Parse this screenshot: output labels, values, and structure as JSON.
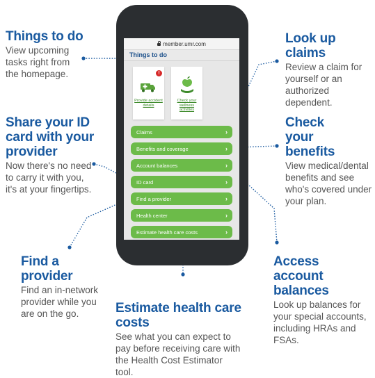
{
  "browser": {
    "url": "member.umr.com"
  },
  "screen": {
    "section_title": "Things to do",
    "cards": [
      {
        "label": "Provide accident details",
        "icon": "ambulance-icon",
        "badge": "!"
      },
      {
        "label": "Check your wellness activities",
        "icon": "apple-in-hand-icon"
      }
    ],
    "menu": [
      {
        "label": "Claims"
      },
      {
        "label": "Benefits and coverage"
      },
      {
        "label": "Account balances"
      },
      {
        "label": "ID card"
      },
      {
        "label": "Find a provider"
      },
      {
        "label": "Health center"
      },
      {
        "label": "Estimate health care costs"
      }
    ]
  },
  "callouts": {
    "things_to_do": {
      "title": "Things to do",
      "text": "View upcoming tasks right from the homepage."
    },
    "share_id": {
      "title": "Share your ID card with your provider",
      "text": "Now there's no need to carry it with you, it's at your fingertips."
    },
    "find_provider": {
      "title": "Find a provider",
      "text": "Find an in-network provider while you are on the go."
    },
    "estimate_costs": {
      "title": "Estimate health care costs",
      "text": "See what you can expect to pay before receiving care with the Health Cost Estimator tool."
    },
    "look_up_claims": {
      "title": "Look up claims",
      "text": "Review a claim for yourself or an authorized dependent."
    },
    "check_benefits": {
      "title": "Check your benefits",
      "text": "View medical/dental benefits and see who's covered under your plan."
    },
    "access_balances": {
      "title": "Access account balances",
      "text": "Look up balances for your special accounts, including HRAs and FSAs."
    }
  },
  "colors": {
    "heading_blue": "#1a5aa0",
    "menu_green": "#6cbb49",
    "phone_body": "#2b2e31",
    "body_text": "#555555"
  }
}
